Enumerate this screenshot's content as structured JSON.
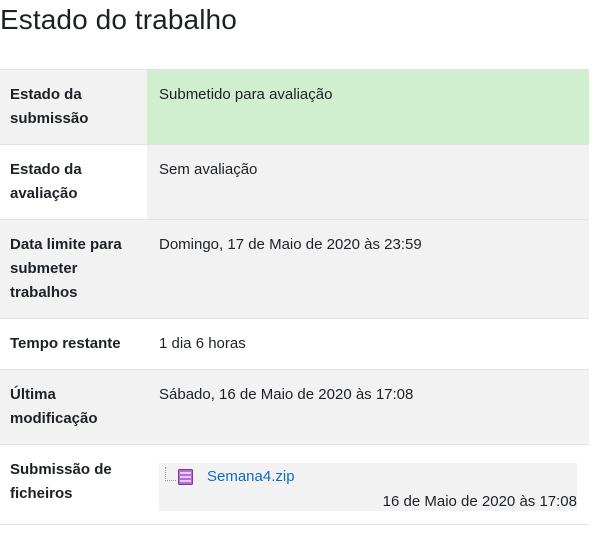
{
  "page": {
    "title": "Estado do trabalho"
  },
  "rows": [
    {
      "label": "Estado da submissão",
      "value": "Submetido para avaliação"
    },
    {
      "label": "Estado da avaliação",
      "value": "Sem avaliação"
    },
    {
      "label": "Data limite para submeter trabalhos",
      "value": "Domingo, 17 de Maio de 2020 às 23:59"
    },
    {
      "label": "Tempo restante",
      "value": "1 dia 6 horas"
    },
    {
      "label": "Última modificação",
      "value": "Sábado, 16 de Maio de 2020 às 17:08"
    },
    {
      "label": "Submissão de ficheiros",
      "value": ""
    }
  ],
  "file": {
    "name": "Semana4.zip",
    "date": "16 de Maio de 2020 às 17:08",
    "icon": "zip-archive-icon"
  },
  "colors": {
    "submitted_bg": "#cfefcf",
    "row_alt_bg": "#f2f2f2",
    "link": "#0f6cbf",
    "zip_icon": "#a04cc4"
  }
}
